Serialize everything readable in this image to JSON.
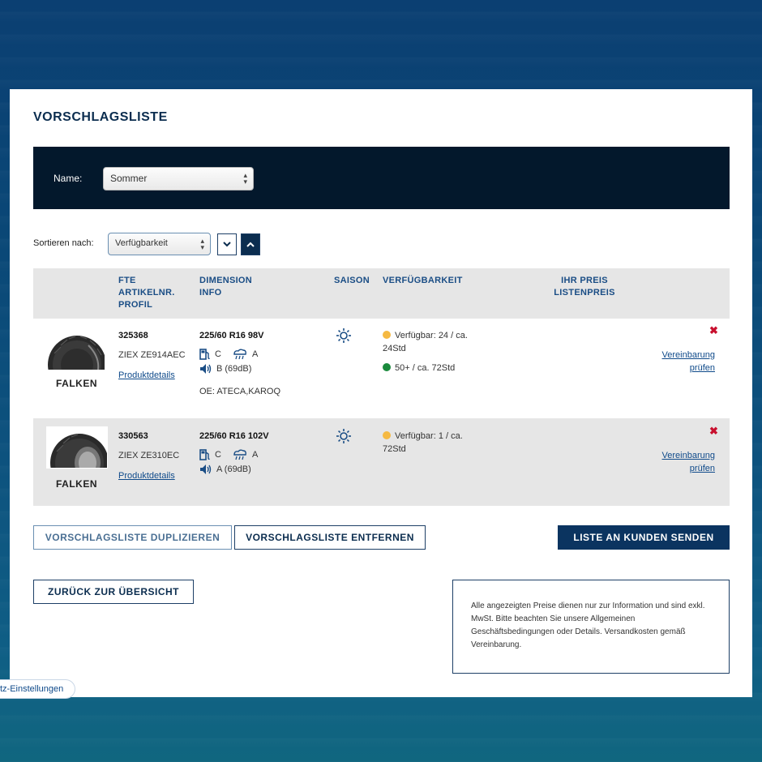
{
  "page": {
    "title": "VORSCHLAGSLISTE"
  },
  "filter": {
    "name_label": "Name:",
    "name_value": "Sommer"
  },
  "sort": {
    "label": "Sortieren nach:",
    "value": "Verfügbarkeit"
  },
  "table": {
    "headers": {
      "col1": [
        "FTE",
        "ARTIKELNR.",
        "PROFIL"
      ],
      "col2": [
        "DIMENSION",
        "INFO"
      ],
      "col3": "SAISON",
      "col4": "VERFÜGBARKEIT",
      "col5": [
        "IHR PREIS",
        "LISTENPREIS"
      ]
    },
    "rows": [
      {
        "brand": "FALKEN",
        "article": "325368",
        "profile": "ZIEX ZE914AEC",
        "details_link": "Produktdetails",
        "dimension": "225/60 R16 98V",
        "fuel": "C",
        "wet": "A",
        "noise": "B (69dB)",
        "oe": "OE: ATECA,KAROQ",
        "availability": [
          {
            "color": "#f5b942",
            "text": "Verfügbar: 24 / ca. 24Std"
          },
          {
            "color": "#1a8a3c",
            "text": "50+ / ca. 72Std"
          }
        ],
        "price_link": "Vereinbarung prüfen"
      },
      {
        "brand": "FALKEN",
        "article": "330563",
        "profile": "ZIEX ZE310EC",
        "details_link": "Produktdetails",
        "dimension": "225/60 R16 102V",
        "fuel": "C",
        "wet": "A",
        "noise": "A (69dB)",
        "oe": "",
        "availability": [
          {
            "color": "#f5b942",
            "text": "Verfügbar: 1 / ca. 72Std"
          }
        ],
        "price_link": "Vereinbarung prüfen"
      }
    ]
  },
  "actions": {
    "duplicate": "VORSCHLAGSLISTE DUPLIZIEREN",
    "remove": "VORSCHLAGSLISTE ENTFERNEN",
    "send": "LISTE AN KUNDEN SENDEN",
    "back": "ZURÜCK ZUR ÜBERSICHT"
  },
  "notice": "Alle angezeigten Preise dienen nur zur Information und sind exkl. MwSt. Bitte beachten Sie unsere Allgemeinen Geschäftsbedingungen oder Details. Versandkosten gemäß Vereinbarung.",
  "cookie": {
    "label": "tz-Einstellungen"
  }
}
